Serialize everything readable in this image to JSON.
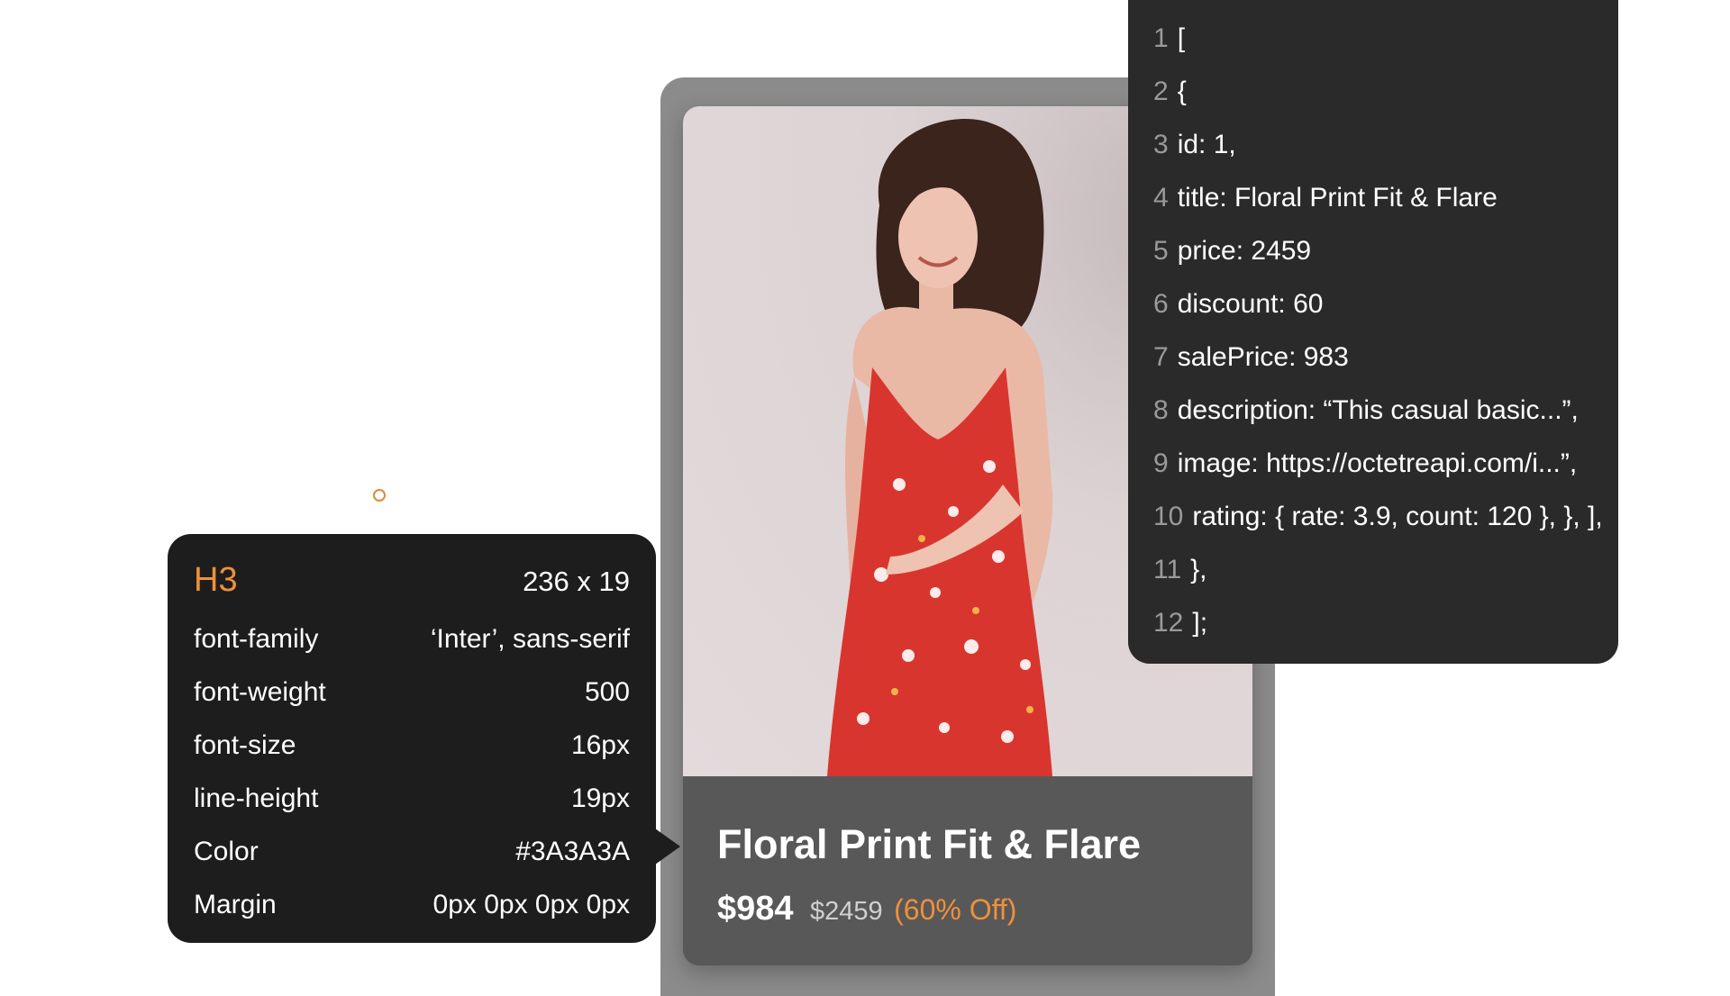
{
  "spec_panel": {
    "tag": "H3",
    "dimensions": "236 x 19",
    "rows": [
      {
        "label": "font-family",
        "value": "‘Inter’, sans-serif"
      },
      {
        "label": "font-weight",
        "value": "500"
      },
      {
        "label": "font-size",
        "value": "16px"
      },
      {
        "label": "line-height",
        "value": "19px"
      },
      {
        "label": "Color",
        "value": "#3A3A3A"
      },
      {
        "label": "Margin",
        "value": "0px 0px 0px 0px"
      }
    ]
  },
  "product_card": {
    "title": "Floral Print Fit & Flare",
    "sale_price": "$984",
    "original_price": "$2459",
    "discount": "(60% Off)"
  },
  "code_panel": {
    "lines": [
      {
        "num": "1",
        "text": "["
      },
      {
        "num": "2",
        "text": "{"
      },
      {
        "num": "3",
        "text": "id: 1,"
      },
      {
        "num": "4",
        "text": "title: Floral Print Fit & Flare"
      },
      {
        "num": "5",
        "text": "price: 2459"
      },
      {
        "num": "6",
        "text": "discount: 60"
      },
      {
        "num": "7",
        "text": "salePrice: 983"
      },
      {
        "num": "8",
        "text": "description: “This casual basic...”,"
      },
      {
        "num": "9",
        "text": "image: https://octetreapi.com/i...”,"
      },
      {
        "num": "10",
        "text": "rating: { rate: 3.9, count: 120 }, }, ],"
      },
      {
        "num": "11",
        "text": "},"
      },
      {
        "num": "12",
        "text": "];"
      }
    ]
  },
  "colors": {
    "accent": "#f0903a",
    "panel": "#1d1d1d",
    "code_bg": "#2b2a2a",
    "card_info": "#585858"
  }
}
